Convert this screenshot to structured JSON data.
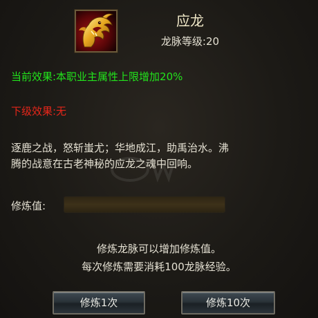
{
  "skill": {
    "icon": "golden-dragon-head-icon",
    "name": "应龙",
    "level_text": "龙脉等级:20"
  },
  "effects": {
    "current": "当前效果:本职业主属性上限增加20%",
    "next": "下级效果:无"
  },
  "description": {
    "line1": "逐鹿之战，怒斩蚩尤；华地成江，助禹治水。沸",
    "line2": "腾的战意在古老神秘的应龙之魂中回响。"
  },
  "cultivation": {
    "label": "修炼值:",
    "progress": 0
  },
  "info": {
    "line1": "修炼龙脉可以增加修炼值。",
    "line2": "每次修炼需要消耗100龙脉经验。"
  },
  "buttons": {
    "once": "修炼1次",
    "ten": "修炼10次"
  },
  "colors": {
    "current_effect": "#22e41c",
    "next_effect": "#e6261a",
    "text": "#e4e0d2",
    "bar_empty": "#3d3119"
  }
}
